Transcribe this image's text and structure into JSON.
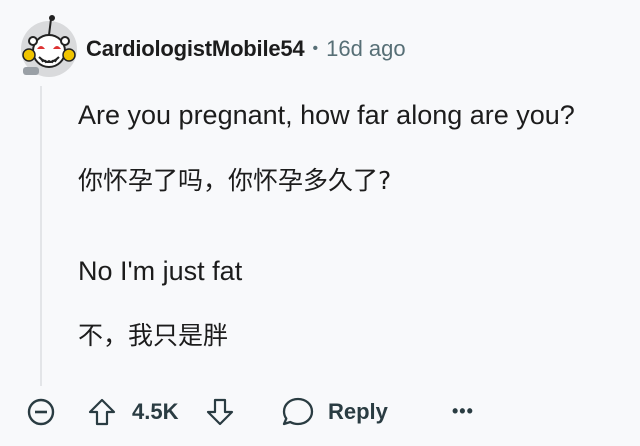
{
  "comment": {
    "username": "CardiologistMobile54",
    "separator": "•",
    "timestamp": "16d ago",
    "lines": [
      "Are you pregnant, how far along are you?",
      "你怀孕了吗，你怀孕多久了?",
      "No I'm just fat",
      "不，我只是胖"
    ]
  },
  "actions": {
    "vote_count": "4.5K",
    "reply_label": "Reply",
    "more_label": "•••"
  },
  "icons": {
    "avatar": "snoo-avatar",
    "collapse": "minus-circle-icon",
    "upvote": "arrow-up-icon",
    "downvote": "arrow-down-icon",
    "reply": "chat-bubble-icon",
    "more": "ellipsis-icon"
  },
  "colors": {
    "text": "#1c1c1c",
    "meta": "#576f76",
    "icon": "#2a3c42",
    "background": "#f8f9fb"
  }
}
